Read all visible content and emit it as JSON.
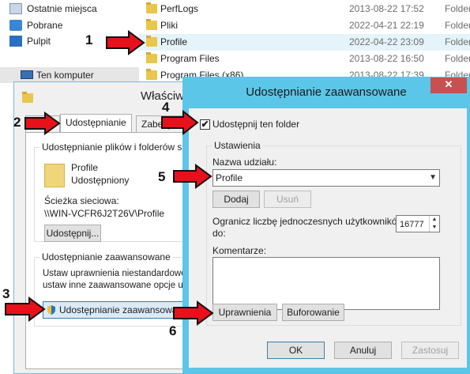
{
  "nav": {
    "items": [
      {
        "label": "Ostatnie miejsca",
        "icon": "recent-places-icon"
      },
      {
        "label": "Pobrane",
        "icon": "downloads-icon"
      },
      {
        "label": "Pulpit",
        "icon": "desktop-icon"
      }
    ],
    "computer": {
      "label": "Ten komputer",
      "icon": "computer-icon"
    }
  },
  "files": [
    {
      "name": "PerfLogs",
      "date": "2013-08-22 17:52",
      "type": "Folder"
    },
    {
      "name": "Pliki",
      "date": "2022-04-21 22:19",
      "type": "Folder"
    },
    {
      "name": "Profile",
      "date": "2022-04-22 23:09",
      "type": "Folder"
    },
    {
      "name": "Program Files",
      "date": "2013-08-22 16:50",
      "type": "Folder"
    },
    {
      "name": "Program Files (x86)",
      "date": "2013-08-22 17:39",
      "type": "Folder"
    }
  ],
  "properties": {
    "title": "Właściw",
    "tabs": {
      "prev": "",
      "sharing": "Udostępnianie",
      "security": "Zabezp"
    },
    "sharing_group": "Udostępnianie plików i folderów siecio",
    "folder_name": "Profile",
    "folder_status": "Udostępniony",
    "network_path_label": "Ścieżka sieciowa:",
    "network_path": "\\\\WIN-VCFR6J2T26V\\Profile",
    "share_button": "Udostępnij...",
    "advanced_group": "Udostępnianie zaawansowane",
    "advanced_desc_1": "Ustaw uprawnienia niestandardowe, t",
    "advanced_desc_2": "ustaw inne zaawansowane opcje udo",
    "advanced_button": "Udostępnianie zaawansowane"
  },
  "dialog": {
    "title": "Udostępnianie zaawansowane",
    "close": "✕",
    "share_checkbox_label": "Udostępnij ten folder",
    "share_checked": true,
    "settings_label": "Ustawienia",
    "share_name_label": "Nazwa udziału:",
    "share_name_value": "Profile",
    "add_button": "Dodaj",
    "remove_button": "Usuń",
    "limit_label_1": "Ogranicz liczbę jednoczesnych użytkowników",
    "limit_label_2": "do:",
    "limit_value": "16777",
    "comments_label": "Komentarze:",
    "permissions_button": "Uprawnienia",
    "caching_button": "Buforowanie",
    "ok_button": "OK",
    "cancel_button": "Anuluj",
    "apply_button": "Zastosuj"
  },
  "annotations": {
    "n1": "1",
    "n2": "2",
    "n3": "3",
    "n4": "4",
    "n5": "5",
    "n6": "6"
  },
  "colors": {
    "dialog_frame": "#5bc6e8",
    "close_button": "#c75050",
    "arrow_fill": "#e8101a",
    "selection": "#e5f3fb"
  }
}
